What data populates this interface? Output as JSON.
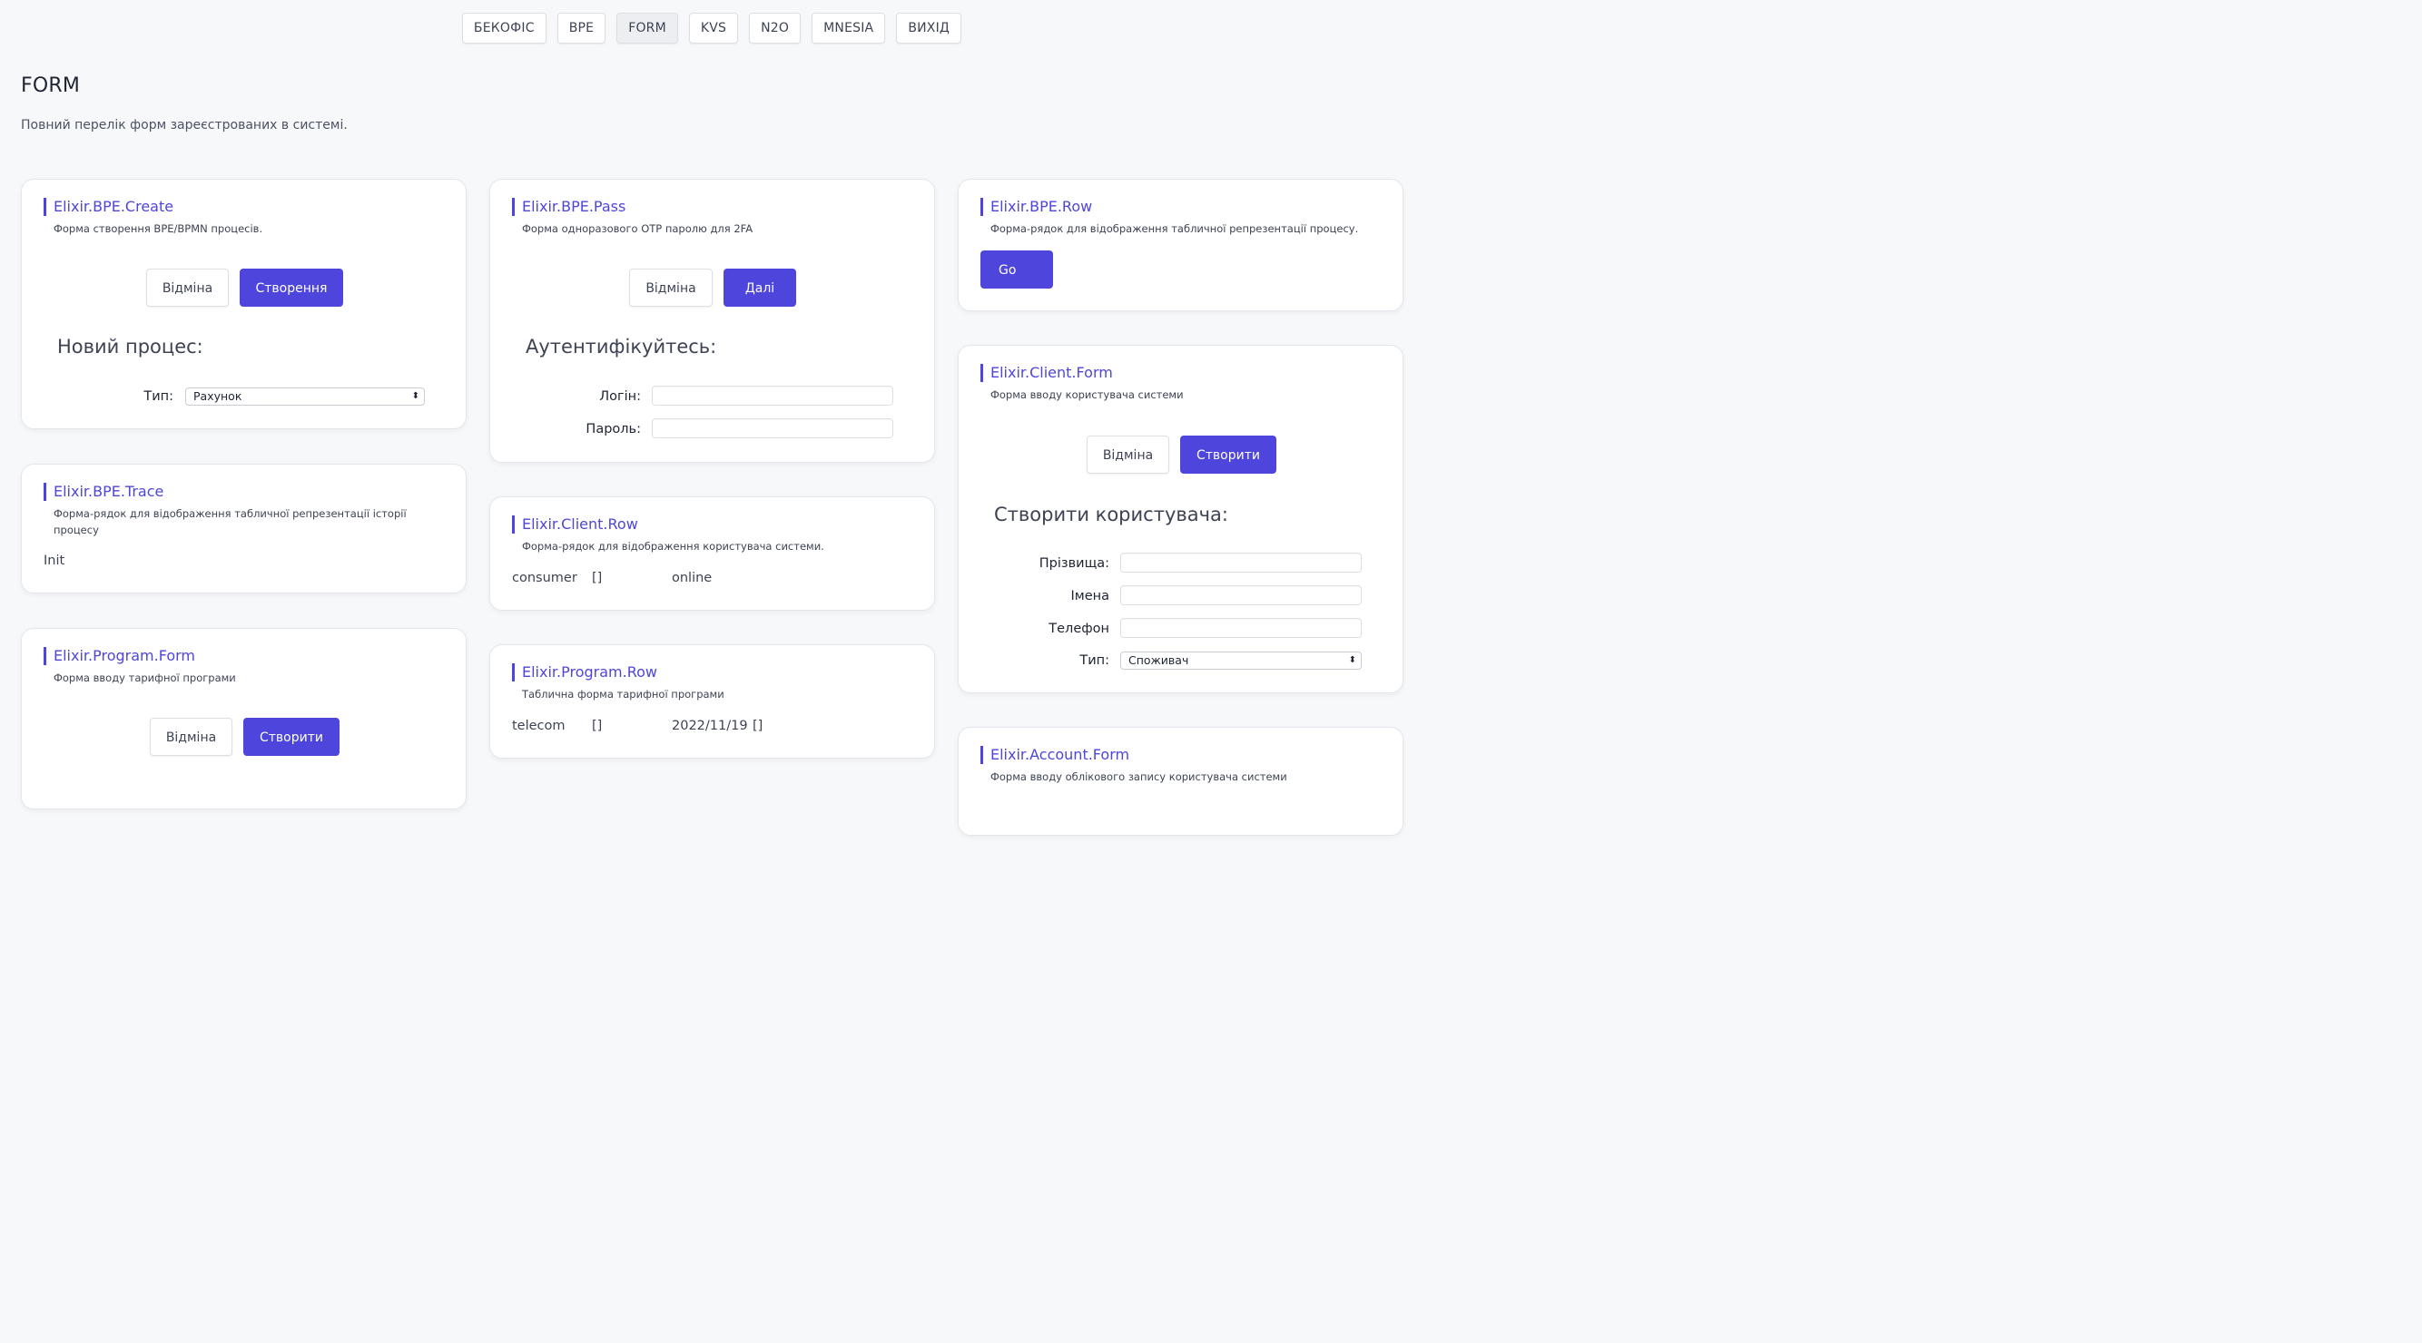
{
  "nav": {
    "tabs": [
      {
        "label": "БЕКОФІС"
      },
      {
        "label": "BPE"
      },
      {
        "label": "FORM",
        "active": true
      },
      {
        "label": "KVS"
      },
      {
        "label": "N2O"
      },
      {
        "label": "MNESIA"
      },
      {
        "label": "ВИХІД"
      }
    ]
  },
  "page": {
    "title": "FORM",
    "description": "Повний перелік форм зареєстрованих в системі."
  },
  "cards": {
    "bpe_create": {
      "title": "Elixir.BPE.Create",
      "subtitle": "Форма створення BPE/BPMN процесів.",
      "cancel": "Відміна",
      "submit": "Створення",
      "heading": "Новий процес:",
      "type_label": "Тип:",
      "type_value": "Рахунок"
    },
    "bpe_trace": {
      "title": "Elixir.BPE.Trace",
      "subtitle_line1": "Форма-рядок для відображення табличної репрезентації історії",
      "subtitle_line2": "процесу",
      "value": "Init"
    },
    "program_form": {
      "title": "Elixir.Program.Form",
      "subtitle": "Форма вводу тарифної програми",
      "cancel": "Відміна",
      "submit": "Створити"
    },
    "bpe_pass": {
      "title": "Elixir.BPE.Pass",
      "subtitle": "Форма одноразового OTP паролю для 2FA",
      "cancel": "Відміна",
      "submit": "Далі",
      "heading": "Аутентифікуйтесь:",
      "login_label": "Логін:",
      "password_label": "Пароль:"
    },
    "client_row": {
      "title": "Elixir.Client.Row",
      "subtitle": "Форма-рядок для відображення користувача системи.",
      "col1": "consumer",
      "col2": "[]",
      "col3": "online"
    },
    "program_row": {
      "title": "Elixir.Program.Row",
      "subtitle": "Таблична форма тарифної програми",
      "col1": "telecom",
      "col2": "[]",
      "col3": "2022/11/19",
      "col4": "[]"
    },
    "bpe_row": {
      "title": "Elixir.BPE.Row",
      "subtitle": "Форма-рядок для відображення табличної репрезентації процесу.",
      "go": "Go"
    },
    "client_form": {
      "title": "Elixir.Client.Form",
      "subtitle": "Форма вводу користувача системи",
      "cancel": "Відміна",
      "submit": "Створити",
      "heading": "Створити користувача:",
      "surname_label": "Прізвища:",
      "names_label": "Імена",
      "phone_label": "Телефон",
      "type_label": "Тип:",
      "type_value": "Споживач"
    },
    "account_form": {
      "title": "Elixir.Account.Form",
      "subtitle": "Форма вводу облікового запису користувача системи"
    }
  }
}
